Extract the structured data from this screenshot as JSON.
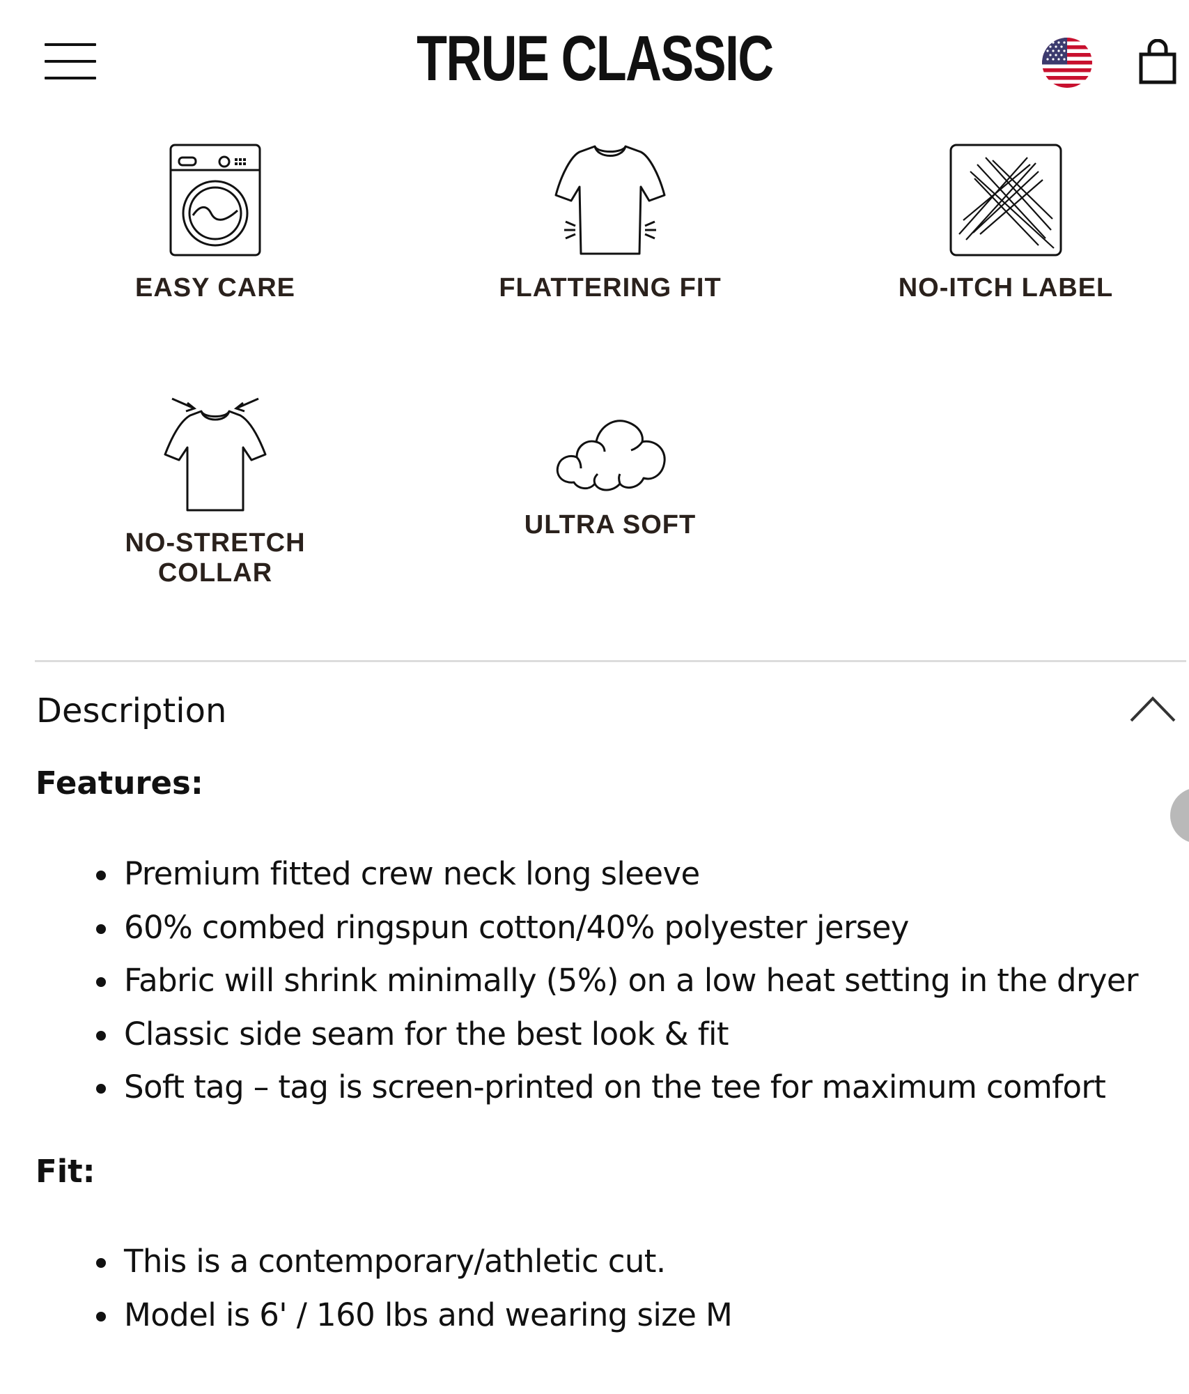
{
  "header": {
    "logo_text": "TRUE CLASSIC",
    "menu_icon": "hamburger-menu-icon",
    "flag_icon": "us-flag-icon",
    "cart_icon": "shopping-bag-icon"
  },
  "features": [
    {
      "label": "EASY CARE",
      "icon": "washing-machine-icon"
    },
    {
      "label": "FLATTERING FIT",
      "icon": "fitted-tshirt-icon"
    },
    {
      "label": "NO-ITCH LABEL",
      "icon": "no-itch-label-icon"
    },
    {
      "label": "NO-STRETCH COLLAR",
      "icon": "collar-tshirt-icon"
    },
    {
      "label": "ULTRA SOFT",
      "icon": "cloud-icon"
    }
  ],
  "description": {
    "title": "Description",
    "toggle_icon": "chevron-up-icon",
    "features_heading": "Features:",
    "features_items": [
      "Premium fitted crew neck long sleeve",
      "60% combed ringspun cotton/40% polyester jersey",
      "Fabric will shrink minimally (5%) on a low heat setting in the dryer",
      "Classic side seam for the best look & fit",
      "Soft tag – tag is screen-printed on the tee for maximum comfort"
    ],
    "fit_heading": "Fit:",
    "fit_items": [
      "This is a contemporary/athletic cut.",
      "Model is 6' / 160 lbs and wearing size M"
    ]
  },
  "colors": {
    "text": "#111111",
    "label": "#2a211c",
    "divider": "#dcdcdc"
  }
}
